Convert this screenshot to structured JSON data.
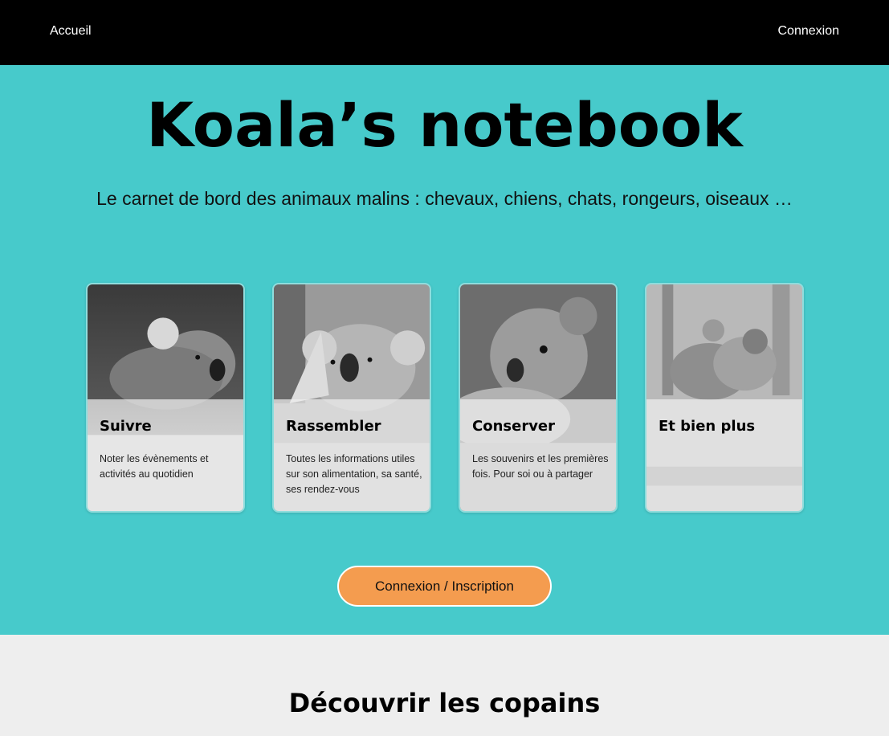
{
  "nav": {
    "home_label": "Accueil",
    "login_label": "Connexion"
  },
  "hero": {
    "title": "Koala’s notebook",
    "subtitle": "Le carnet de bord des animaux malins : chevaux, chiens, chats, rongeurs, oiseaux …",
    "cta_label": "Connexion / Inscription"
  },
  "cards": [
    {
      "title": "Suivre",
      "text": "Noter les évènements et activités au quotidien",
      "image": "koala-side-photo"
    },
    {
      "title": "Rassembler",
      "text": "Toutes les informations utiles sur son alimentation, sa santé, ses rendez-vous",
      "image": "koala-eating-photo"
    },
    {
      "title": "Conserver",
      "text": "Les souvenirs et les premières fois. Pour soi ou à partager",
      "image": "koala-face-photo"
    },
    {
      "title": "Et bien plus",
      "text": "",
      "image": "koala-group-photo"
    }
  ],
  "discover": {
    "title": "Découvrir les copains"
  },
  "colors": {
    "topbar": "#000000",
    "hero_background": "#47cacb",
    "cta_background": "#f49c4f",
    "lower_background": "#eeeeee"
  }
}
